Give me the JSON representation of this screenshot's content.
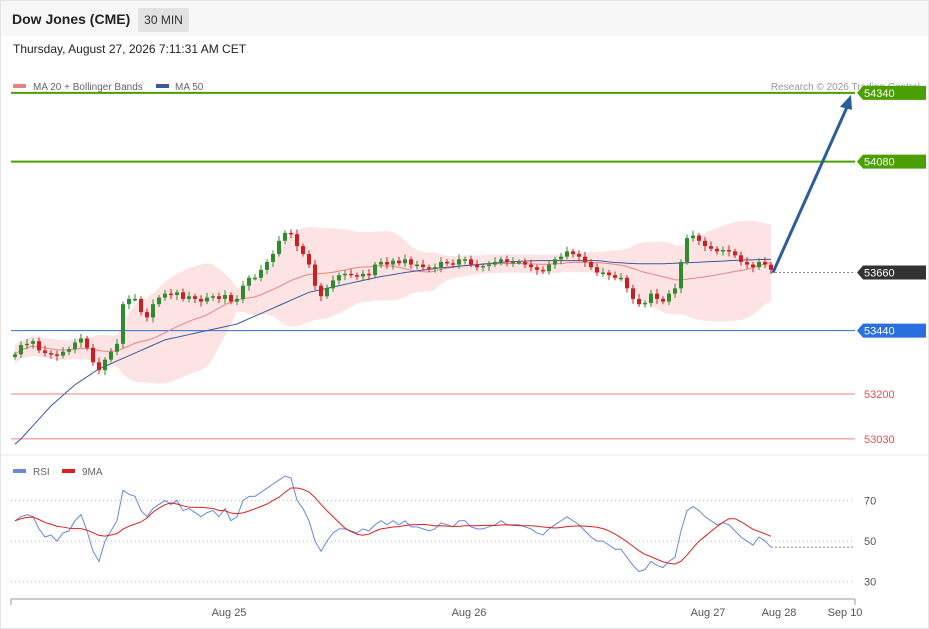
{
  "header": {
    "title": "Dow Jones (CME)",
    "interval": "30 MIN",
    "datetime": "Thursday, August 27, 2026 7:11:31 AM CET"
  },
  "legend": {
    "ma20": "MA 20 + Bollinger Bands",
    "ma50": "MA 50",
    "copyright": "Research © 2026 Trading Central"
  },
  "rsi_legend": {
    "rsi": "RSI",
    "ma": "9MA"
  },
  "colors": {
    "up": "#2e8b2e",
    "down": "#cc2020",
    "resistance": "#4aa000",
    "support": "#2a6fe0",
    "band_fill": "#fde0e0",
    "ma20": "#f08080",
    "ma50": "#3a5a9a",
    "arrow": "#2c5d9b",
    "current": "#333333",
    "minor_support": "#f08080",
    "rsi": "#6688dd",
    "rsi_ma": "#dd2020"
  },
  "chart_data": [
    {
      "type": "candlestick",
      "x_ticks": [
        "Aug 25",
        "Aug 26",
        "Aug 27",
        "Aug 28",
        "Sep 10"
      ],
      "ylim": [
        52950,
        54370
      ],
      "levels": [
        {
          "value": 54340,
          "label": "54340",
          "kind": "resistance"
        },
        {
          "value": 54080,
          "label": "54080",
          "kind": "resistance"
        },
        {
          "value": 53660,
          "label": "53660",
          "kind": "current"
        },
        {
          "value": 53440,
          "label": "53440",
          "kind": "support"
        },
        {
          "value": 53200,
          "label": "53200",
          "kind": "minor_support"
        },
        {
          "value": 53030,
          "label": "53030",
          "kind": "minor_support"
        }
      ],
      "forecast": {
        "from": 53660,
        "to": 54340
      },
      "closes": [
        53350,
        53385,
        53390,
        53400,
        53365,
        53355,
        53350,
        53345,
        53360,
        53370,
        53395,
        53410,
        53375,
        53320,
        53290,
        53330,
        53360,
        53390,
        53540,
        53560,
        53560,
        53510,
        53490,
        53540,
        53565,
        53580,
        53575,
        53585,
        53560,
        53570,
        53560,
        53550,
        53565,
        53570,
        53560,
        53575,
        53550,
        53560,
        53610,
        53640,
        53640,
        53670,
        53700,
        53730,
        53780,
        53810,
        53805,
        53760,
        53730,
        53690,
        53610,
        53570,
        53600,
        53630,
        53650,
        53655,
        53650,
        53645,
        53655,
        53650,
        53690,
        53700,
        53690,
        53705,
        53695,
        53710,
        53690,
        53690,
        53680,
        53675,
        53680,
        53700,
        53695,
        53690,
        53710,
        53710,
        53690,
        53680,
        53685,
        53690,
        53700,
        53710,
        53700,
        53700,
        53700,
        53690,
        53680,
        53670,
        53665,
        53690,
        53710,
        53720,
        53740,
        53730,
        53720,
        53700,
        53680,
        53660,
        53660,
        53650,
        53640,
        53640,
        53600,
        53560,
        53540,
        53545,
        53580,
        53560,
        53550,
        53580,
        53600,
        53700,
        53790,
        53800,
        53780,
        53760,
        53750,
        53740,
        53745,
        53740,
        53725,
        53700,
        53690,
        53680,
        53700,
        53690,
        53670
      ],
      "ma50": [
        53010,
        53030,
        53055,
        53080,
        53105,
        53130,
        53155,
        53175,
        53195,
        53215,
        53235,
        53250,
        53265,
        53280,
        53295,
        53305,
        53315,
        53325,
        53335,
        53345,
        53355,
        53365,
        53375,
        53385,
        53395,
        53405,
        53410,
        53415,
        53420,
        53425,
        53430,
        53435,
        53440,
        53445,
        53450,
        53455,
        53460,
        53465,
        53475,
        53485,
        53495,
        53505,
        53515,
        53525,
        53535,
        53545,
        53555,
        53565,
        53575,
        53585,
        53590,
        53595,
        53600,
        53605,
        53610,
        53615,
        53620,
        53625,
        53630,
        53635,
        53640,
        53645,
        53648,
        53652,
        53656,
        53660,
        53663,
        53666,
        53669,
        53672,
        53675,
        53678,
        53680,
        53682,
        53684,
        53686,
        53688,
        53690,
        53692,
        53694,
        53696,
        53698,
        53700,
        53701,
        53702,
        53703,
        53704,
        53705,
        53705,
        53705,
        53705,
        53705,
        53705,
        53705,
        53705,
        53705,
        53705,
        53705,
        53703,
        53700,
        53698,
        53697,
        53695,
        53694,
        53693,
        53693,
        53693,
        53693,
        53693,
        53694,
        53695,
        53696,
        53697,
        53698,
        53699,
        53700,
        53701,
        53702,
        53703,
        53705,
        53706,
        53707,
        53708,
        53708,
        53709,
        53709,
        53710
      ],
      "rsi": [
        60,
        62,
        63,
        62,
        56,
        52,
        53,
        50,
        54,
        55,
        60,
        63,
        55,
        45,
        40,
        50,
        55,
        60,
        75,
        73,
        72,
        65,
        62,
        66,
        68,
        70,
        68,
        70,
        65,
        66,
        64,
        62,
        64,
        65,
        62,
        66,
        60,
        62,
        70,
        72,
        72,
        74,
        76,
        78,
        80,
        82,
        81,
        70,
        66,
        60,
        50,
        45,
        50,
        54,
        56,
        56,
        55,
        54,
        56,
        55,
        58,
        60,
        58,
        60,
        58,
        60,
        57,
        57,
        56,
        55,
        56,
        59,
        58,
        57,
        60,
        60,
        57,
        56,
        56,
        57,
        58,
        60,
        58,
        58,
        58,
        57,
        56,
        54,
        53,
        56,
        58,
        60,
        62,
        60,
        58,
        55,
        52,
        50,
        50,
        48,
        46,
        46,
        42,
        38,
        35,
        36,
        40,
        38,
        37,
        40,
        42,
        55,
        65,
        67,
        65,
        62,
        60,
        58,
        59,
        58,
        55,
        52,
        50,
        48,
        52,
        50,
        47
      ],
      "rsi_ylim": [
        22,
        82
      ],
      "rsi_levels": [
        {
          "value": 70,
          "label": "70"
        },
        {
          "value": 50,
          "label": "50"
        },
        {
          "value": 30,
          "label": "30"
        }
      ]
    }
  ]
}
